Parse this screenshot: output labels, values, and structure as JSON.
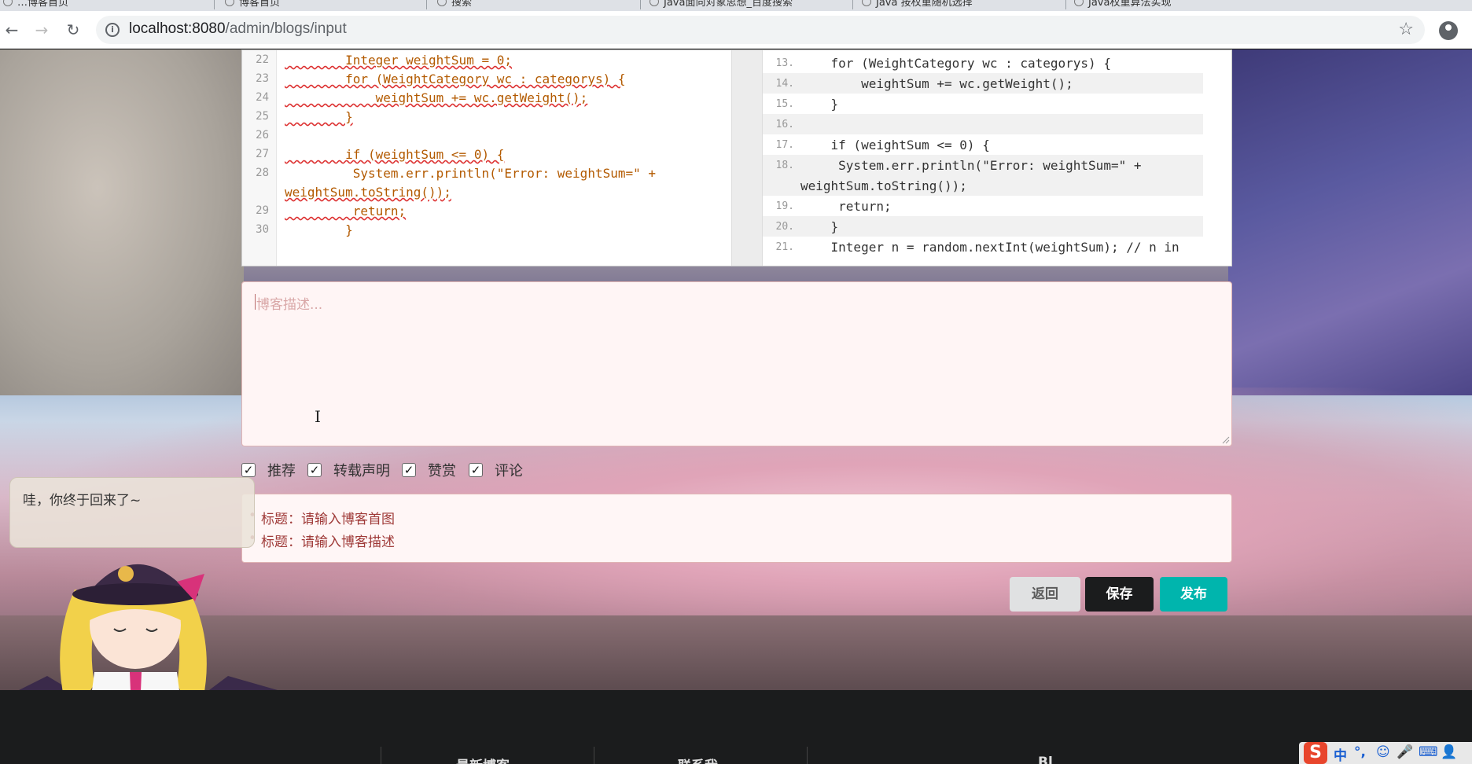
{
  "browser": {
    "tabs": [
      "…博客首页",
      "博客首页",
      "搜索",
      "Java面向对象思想_百度搜索",
      "Java 按权重随机选择",
      "Java权重算法实现"
    ],
    "url_host": "localhost:8080",
    "url_path": "/admin/blogs/input"
  },
  "editor": {
    "left_lines": [
      {
        "num": "22",
        "code": "        Integer weightSum = 0;"
      },
      {
        "num": "23",
        "code": "        for (WeightCategory wc : categorys) {"
      },
      {
        "num": "24",
        "code": "            weightSum += wc.getWeight();"
      },
      {
        "num": "25",
        "code": "        }"
      },
      {
        "num": "26",
        "code": ""
      },
      {
        "num": "27",
        "code": "        if (weightSum <= 0) {"
      },
      {
        "num": "28",
        "code": "         System.err.println(\"Error: weightSum=\" +"
      },
      {
        "num": "",
        "code": "weightSum.toString());"
      },
      {
        "num": "29",
        "code": "         return;"
      },
      {
        "num": "30",
        "code": "        }"
      }
    ],
    "right_lines": [
      {
        "num": "13.",
        "code": "    for (WeightCategory wc : categorys) {"
      },
      {
        "num": "14.",
        "code": "        weightSum += wc.getWeight();"
      },
      {
        "num": "15.",
        "code": "    }"
      },
      {
        "num": "16.",
        "code": ""
      },
      {
        "num": "17.",
        "code": "    if (weightSum <= 0) {"
      },
      {
        "num": "18.",
        "code": "     System.err.println(\"Error: weightSum=\" +"
      },
      {
        "num": "",
        "code": "weightSum.toString());"
      },
      {
        "num": "19.",
        "code": "     return;"
      },
      {
        "num": "20.",
        "code": "    }"
      },
      {
        "num": "21.",
        "code": "    Integer n = random.nextInt(weightSum); // n in"
      }
    ]
  },
  "form": {
    "description_placeholder": "博客描述...",
    "checkboxes": [
      {
        "label": "推荐",
        "checked": true
      },
      {
        "label": "转载声明",
        "checked": true
      },
      {
        "label": "赞赏",
        "checked": true
      },
      {
        "label": "评论",
        "checked": true
      }
    ],
    "errors": [
      "标题：请输入博客首图",
      "标题：请输入博客描述"
    ],
    "buttons": {
      "back": "返回",
      "save": "保存",
      "publish": "发布"
    }
  },
  "mascot": {
    "message": "哇，你终于回来了~"
  },
  "footer": {
    "col1": "最新博客",
    "col2": "联系我",
    "col3": "Bl"
  },
  "ime": {
    "lang": "中"
  },
  "colors": {
    "save": "#1b1c1d",
    "publish": "#00b5ad",
    "error": "#9f3a38",
    "error_bg": "#fff6f6"
  }
}
